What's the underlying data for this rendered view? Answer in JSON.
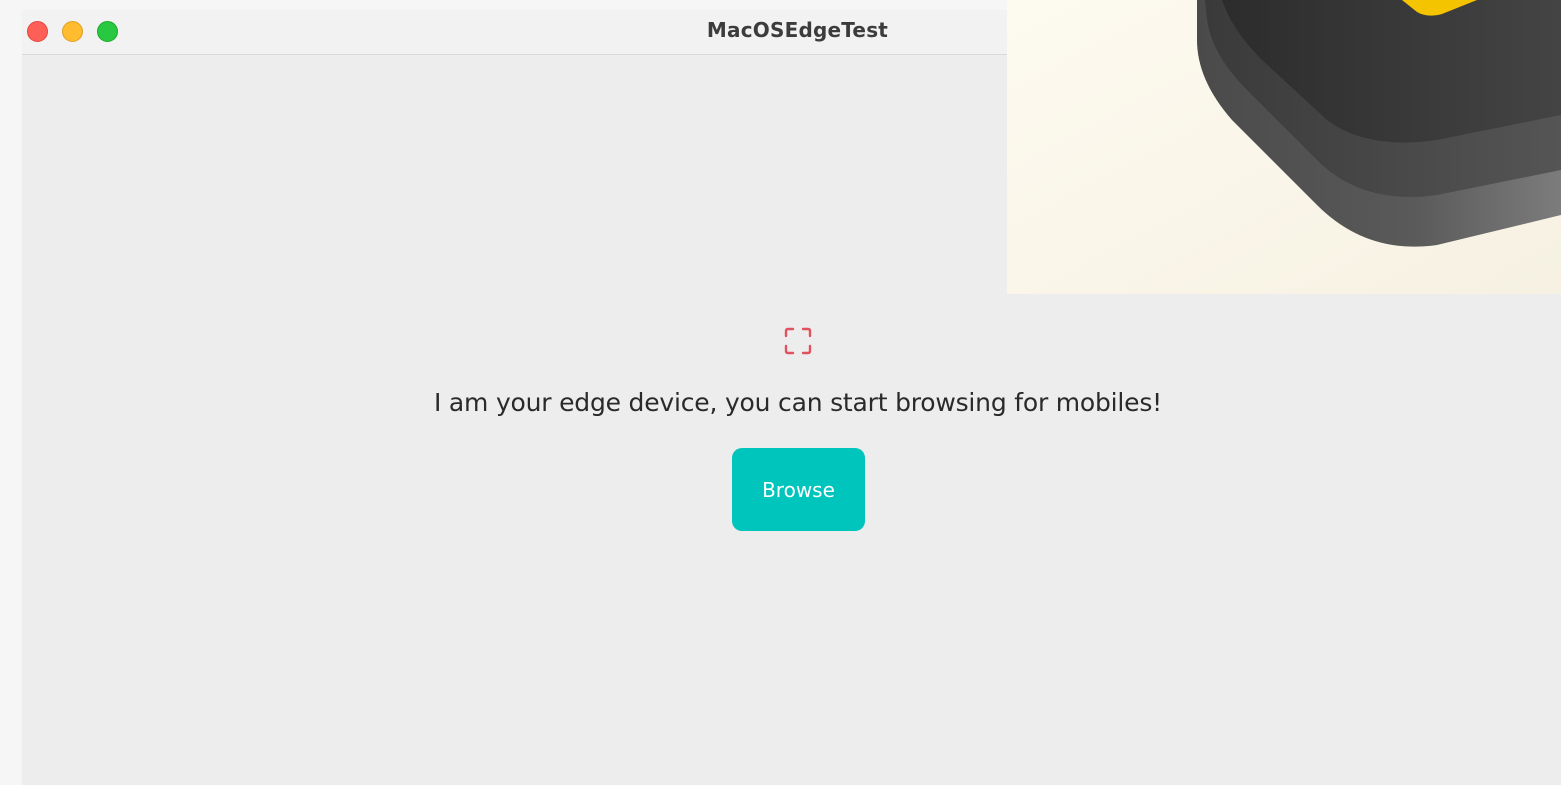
{
  "window": {
    "title": "MacOSEdgeTest"
  },
  "content": {
    "message": "I am your edge device, you can start browsing for mobiles!",
    "browse_label": "Browse",
    "scan_icon": "scan-frame-icon"
  },
  "colors": {
    "accent": "#00c5bc",
    "scan_icon": "#e0525e",
    "close": "#fe5f57",
    "minimize": "#febc2e",
    "zoom": "#28c840"
  }
}
